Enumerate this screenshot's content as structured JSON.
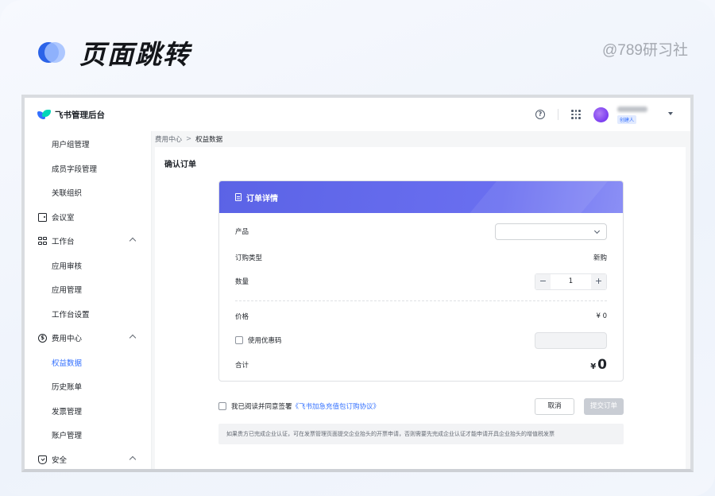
{
  "headline": {
    "title": "页面跳转",
    "watermark": "@789研习社"
  },
  "topbar": {
    "brand": "飞书管理后台",
    "help_glyph": "?",
    "user_role": "创建人"
  },
  "sidebar": {
    "items": [
      {
        "label": "用户组管理",
        "type": "sub"
      },
      {
        "label": "成员字段管理",
        "type": "sub"
      },
      {
        "label": "关联组织",
        "type": "sub"
      },
      {
        "label": "会议室",
        "type": "group",
        "icon": "meeting-room-icon"
      },
      {
        "label": "工作台",
        "type": "group",
        "icon": "workspace-icon",
        "expanded": true
      },
      {
        "label": "应用审核",
        "type": "sub"
      },
      {
        "label": "应用管理",
        "type": "sub"
      },
      {
        "label": "工作台设置",
        "type": "sub"
      },
      {
        "label": "费用中心",
        "type": "group",
        "icon": "fee-icon",
        "expanded": true,
        "icon_glyph": "$"
      },
      {
        "label": "权益数据",
        "type": "sub",
        "active": true
      },
      {
        "label": "历史账单",
        "type": "sub"
      },
      {
        "label": "发票管理",
        "type": "sub"
      },
      {
        "label": "账户管理",
        "type": "sub"
      },
      {
        "label": "安全",
        "type": "group",
        "icon": "shield-icon",
        "expanded": true
      }
    ]
  },
  "breadcrumb": {
    "parent": "费用中心",
    "separator": ">",
    "current": "权益数据"
  },
  "page": {
    "title": "确认订单",
    "card_title": "订单详情",
    "product_label": "产品",
    "product_value": "",
    "order_type_label": "订购类型",
    "order_type_value": "新购",
    "quantity_label": "数量",
    "quantity_minus": "−",
    "quantity_value": "1",
    "quantity_plus": "+",
    "price_label": "价格",
    "price_value": "¥ 0",
    "coupon_label": "使用优惠码",
    "coupon_value": "",
    "total_label": "合计",
    "total_currency": "¥",
    "total_value": "0",
    "agree_text": "我已阅读并同意签署",
    "agree_link": "《飞书加急充值包订购协议》",
    "cancel_label": "取消",
    "submit_label": "提交订单",
    "notice": "如果贵方已完成企业认证，可在发票管理页面提交企业抬头的开票申请，否则需要先完成企业认证才能申请开具企业抬头的增值税发票"
  },
  "colors": {
    "accent": "#3370ff",
    "header_gradient_start": "#5b63e6",
    "header_gradient_end": "#8b8ff5"
  }
}
